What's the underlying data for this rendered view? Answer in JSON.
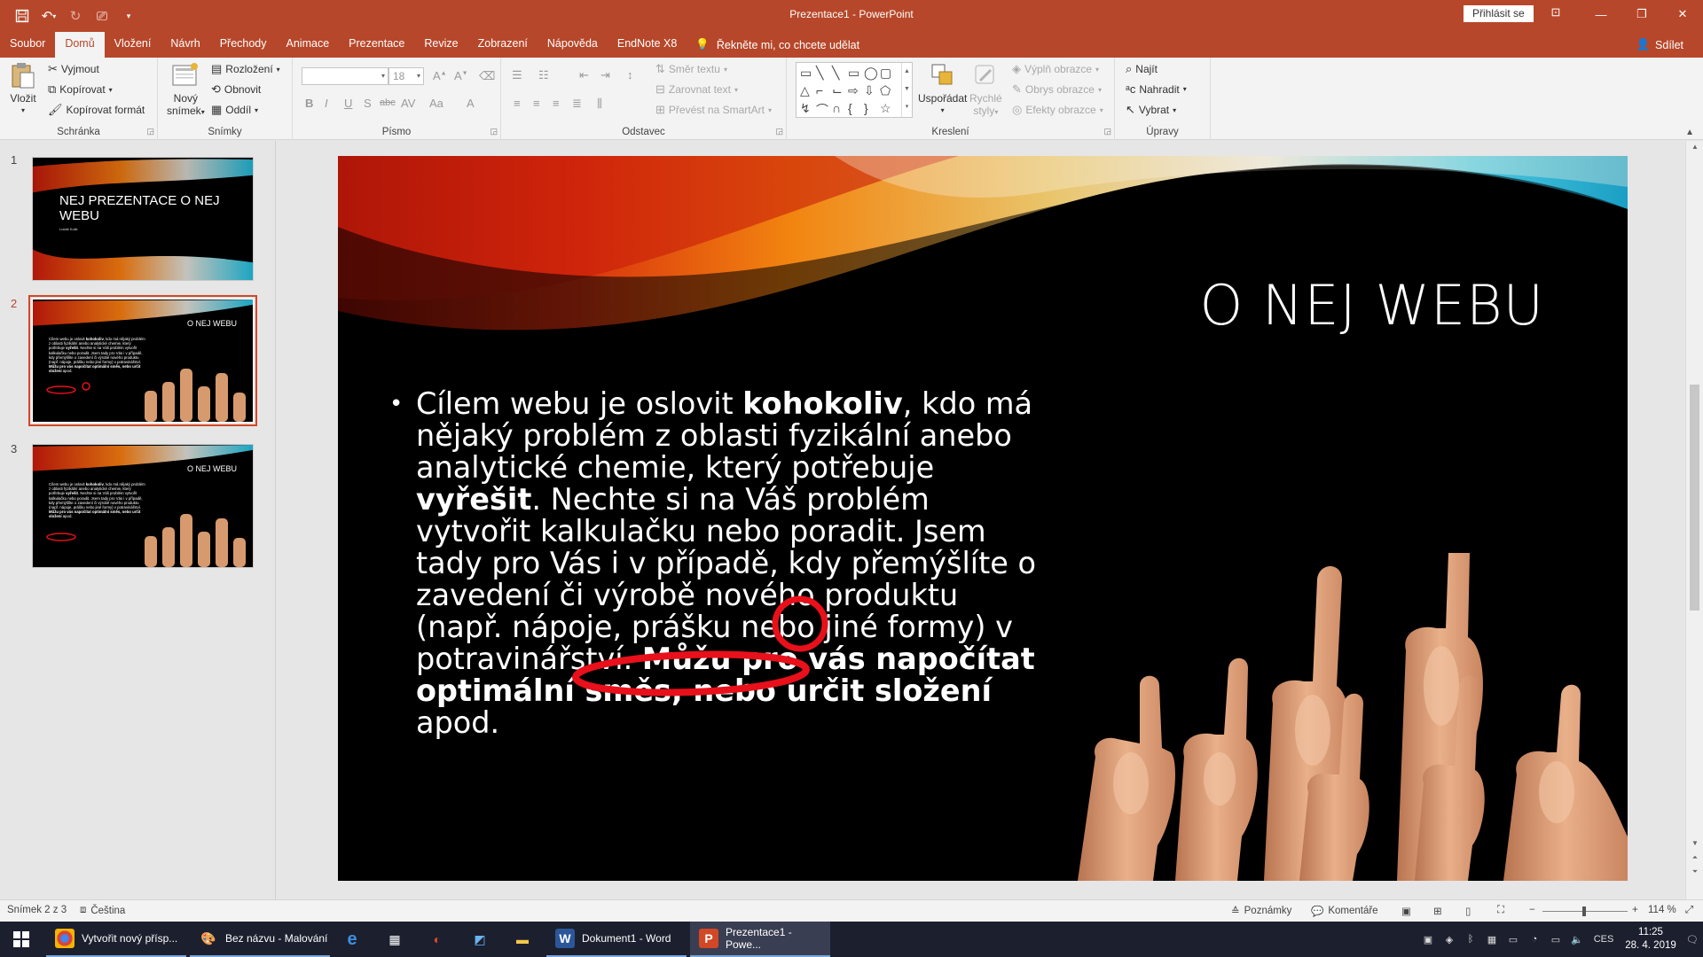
{
  "app": {
    "window_title": "Prezentace1 - PowerPoint",
    "signin_label": "Přihlásit se",
    "tell_me": "Řekněte mi, co chcete udělat",
    "share_label": "Sdílet"
  },
  "tabs": [
    "Soubor",
    "Domů",
    "Vložení",
    "Návrh",
    "Přechody",
    "Animace",
    "Prezentace",
    "Revize",
    "Zobrazení",
    "Nápověda",
    "EndNote X8"
  ],
  "active_tab": "Domů",
  "ribbon": {
    "clipboard": {
      "label": "Schránka",
      "paste": "Vložit",
      "cut": "Vyjmout",
      "copy": "Kopírovat",
      "format_painter": "Kopírovat formát"
    },
    "slides": {
      "label": "Snímky",
      "new_slide_1": "Nový",
      "new_slide_2": "snímek",
      "layout": "Rozložení",
      "reset": "Obnovit",
      "section": "Oddíl"
    },
    "font": {
      "label": "Písmo",
      "font_name": "",
      "font_size": "18"
    },
    "paragraph": {
      "label": "Odstavec",
      "text_direction": "Směr textu",
      "align_text": "Zarovnat text",
      "smartart": "Převést na SmartArt"
    },
    "drawing": {
      "label": "Kreslení",
      "arrange": "Uspořádat",
      "quick_styles_1": "Rychlé",
      "quick_styles_2": "styly",
      "shape_fill": "Výplň obrazce",
      "shape_outline": "Obrys obrazce",
      "shape_effects": "Efekty obrazce"
    },
    "editing": {
      "label": "Úpravy",
      "find": "Najít",
      "replace": "Nahradit",
      "select": "Vybrat"
    }
  },
  "thumbnails": [
    {
      "num": "1",
      "title": "NEJ PREZENTACE O NEJ WEBU",
      "subtitle": "Lukáš Kulik"
    },
    {
      "num": "2",
      "title": "O NEJ WEBU"
    },
    {
      "num": "3",
      "title": "O NEJ WEBU"
    }
  ],
  "slide": {
    "title": "O NEJ WEBU",
    "bullet": "•",
    "p1": "Cílem webu je oslovit ",
    "b1": "kohokoliv",
    "p2": ", kdo má nějaký problém z oblasti fyzikální anebo analytické chemie, který potřebuje ",
    "b2": "vyřešit",
    "p3": ". Nechte si na Váš problém vytvořit kalkulačku nebo poradit. Jsem tady pro Vás i v případě, kdy přemýšlíte o zavedení či výrobě nového produktu (např. nápoje, prášku nebo jiné formy) v potravinářství. ",
    "b3": "Můžu pro vás napočítat optimální směs, nebo určit složení",
    "p4": " apod."
  },
  "status": {
    "slide_counter": "Snímek 2 z 3",
    "language": "Čeština",
    "notes": "Poznámky",
    "comments": "Komentáře",
    "zoom": "114 %"
  },
  "taskbar": {
    "apps": [
      {
        "label": "Vytvořit nový přísp..."
      },
      {
        "label": "Bez názvu - Malování"
      },
      {
        "label": ""
      },
      {
        "label": ""
      },
      {
        "label": ""
      },
      {
        "label": ""
      },
      {
        "label": ""
      },
      {
        "label": "Dokument1 - Word"
      },
      {
        "label": "Prezentace1 - Powe..."
      }
    ],
    "lang": "CES",
    "time": "11:25",
    "date": "28. 4. 2019"
  },
  "colors": {
    "accent": "#b7472a",
    "annotation_red": "#e8101a"
  }
}
